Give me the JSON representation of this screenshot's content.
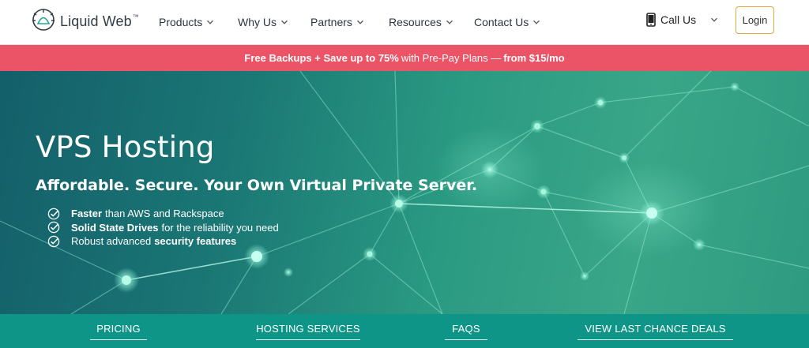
{
  "header": {
    "logo_text": "Liquid Web",
    "logo_tm": "™",
    "nav": [
      {
        "label": "Products"
      },
      {
        "label": "Why Us"
      },
      {
        "label": "Partners"
      },
      {
        "label": "Resources"
      },
      {
        "label": "Contact Us"
      }
    ],
    "call_label": "Call Us",
    "login_label": "Login"
  },
  "promo": {
    "part1": "Free Backups + Save up to 75%",
    "part2": "with Pre-Pay Plans —",
    "part3": "from $15/mo"
  },
  "hero": {
    "title": "VPS Hosting",
    "subtitle": "Affordable. Secure. Your Own Virtual Private Server.",
    "features": [
      {
        "bold": "Faster",
        "rest": "than AWS and Rackspace",
        "bold_first": true
      },
      {
        "bold": "Solid State Drives",
        "rest": "for the reliability you need",
        "bold_first": true
      },
      {
        "bold": "security features",
        "rest": "Robust advanced",
        "bold_first": false
      }
    ]
  },
  "tabs": [
    {
      "label": "PRICING"
    },
    {
      "label": "HOSTING SERVICES"
    },
    {
      "label": "FAQS"
    },
    {
      "label": "VIEW LAST CHANCE DEALS"
    }
  ],
  "colors": {
    "promo_bg": "#eb5466",
    "tabs_bg": "#0f9488",
    "login_border": "#e2a93f",
    "hero_teal": "#1a7674"
  }
}
